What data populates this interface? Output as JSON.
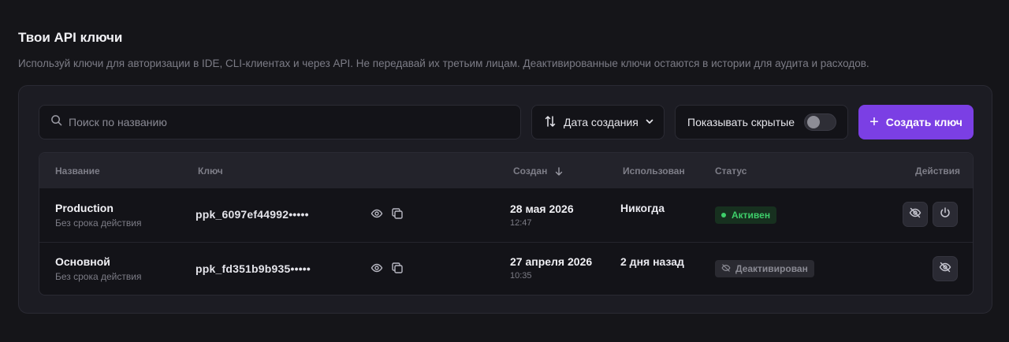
{
  "header": {
    "title": "Твои API ключи",
    "subtitle": "Используй ключи для авторизации в IDE, CLI-клиентах и через API. Не передавай их третьим лицам. Деактивированные ключи остаются в истории для аудита и расходов."
  },
  "toolbar": {
    "search_placeholder": "Поиск по названию",
    "search_value": "",
    "sort_label": "Дата создания",
    "show_hidden_label": "Показывать скрытые",
    "show_hidden_on": false,
    "create_label": "Создать ключ",
    "create_icon": "+"
  },
  "table": {
    "headers": {
      "name": "Название",
      "key": "Ключ",
      "created": "Создан",
      "used": "Использован",
      "status": "Статус",
      "actions": "Действия"
    },
    "rows": [
      {
        "name": "Production",
        "expiry": "Без срока действия",
        "key": "ppk_6097ef44992•••••",
        "date": "28 мая 2026",
        "time": "12:47",
        "used": "Никогда",
        "status": "Активен",
        "status_type": "active"
      },
      {
        "name": "Основной",
        "expiry": "Без срока действия",
        "key": "ppk_fd351b9b935•••••",
        "date": "27 апреля 2026",
        "time": "10:35",
        "used": "2 дня назад",
        "status": "Деактивирован",
        "status_type": "inactive"
      }
    ]
  },
  "colors": {
    "background": "#151519",
    "panel": "#1c1c23",
    "accent": "#7b3fe4",
    "active_green": "#3ecf6a"
  }
}
